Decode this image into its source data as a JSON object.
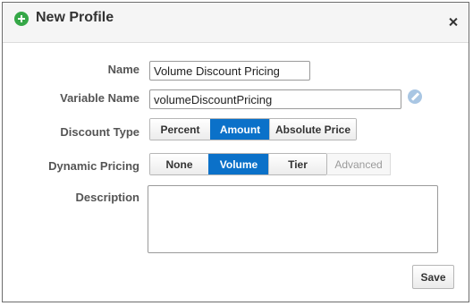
{
  "dialog": {
    "title": "New Profile",
    "title_icon": "add-circle-icon",
    "close_icon": "close-icon"
  },
  "form": {
    "name": {
      "label": "Name",
      "value": "Volume Discount Pricing"
    },
    "variable_name": {
      "label": "Variable Name",
      "value": "volumeDiscountPricing",
      "edit_icon": "pencil-icon"
    },
    "discount_type": {
      "label": "Discount Type",
      "options": [
        "Percent",
        "Amount",
        "Absolute Price"
      ],
      "selected": "Amount"
    },
    "dynamic_pricing": {
      "label": "Dynamic Pricing",
      "options": [
        "None",
        "Volume",
        "Tier",
        "Advanced"
      ],
      "selected": "Volume",
      "disabled": [
        "Advanced"
      ]
    },
    "description": {
      "label": "Description",
      "value": ""
    }
  },
  "footer": {
    "save_label": "Save"
  },
  "colors": {
    "accent": "#0b71c9",
    "add_icon": "#35a747",
    "edit_icon": "#a9c6e3"
  }
}
